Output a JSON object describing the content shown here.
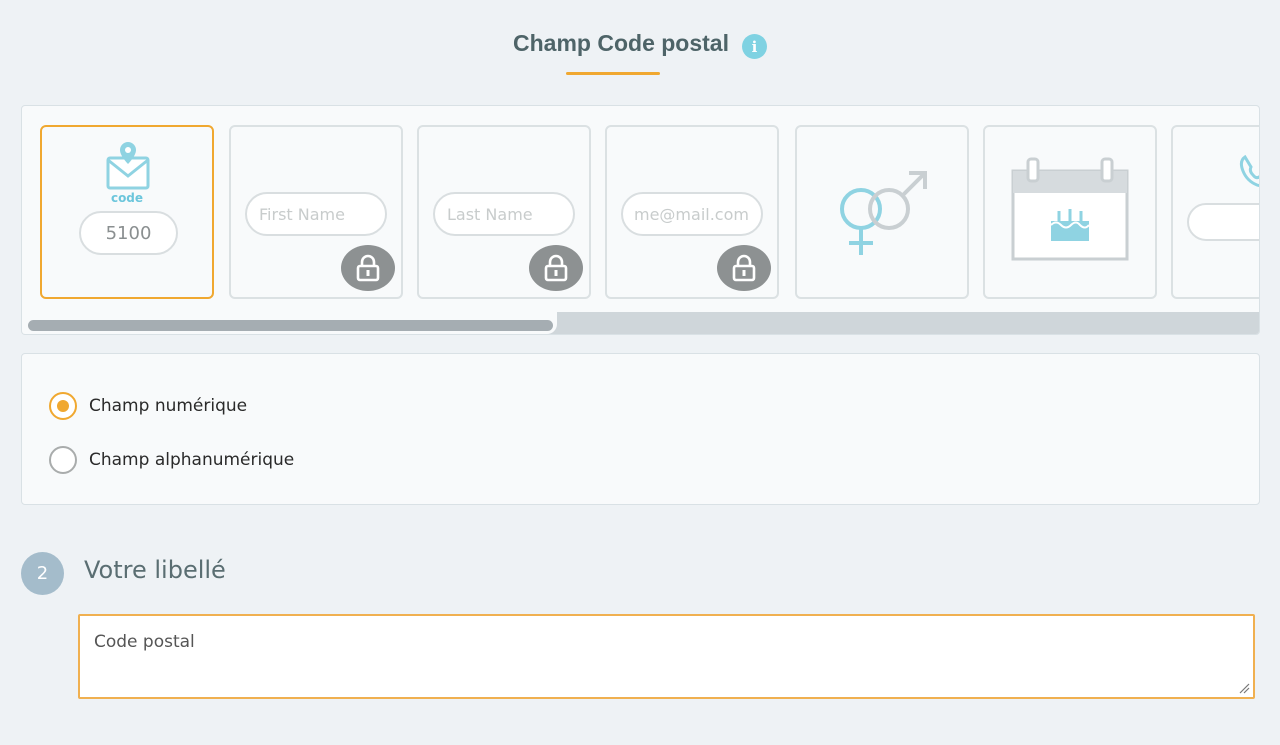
{
  "header": {
    "title": "Champ Code postal",
    "info_icon": "info-icon",
    "accent": "#f0a830"
  },
  "cards": [
    {
      "id": "postal-code",
      "icon": "mail-location-icon",
      "caption": "code",
      "sample_value": "5100",
      "selected": true,
      "locked": false
    },
    {
      "id": "first-name",
      "placeholder": "First Name",
      "selected": false,
      "locked": true
    },
    {
      "id": "last-name",
      "placeholder": "Last Name",
      "selected": false,
      "locked": true
    },
    {
      "id": "email",
      "placeholder": "me@mail.com",
      "selected": false,
      "locked": true
    },
    {
      "id": "gender",
      "icon": "gender-icon",
      "selected": false,
      "locked": false
    },
    {
      "id": "birthday",
      "icon": "birthday-calendar-icon",
      "selected": false,
      "locked": false
    },
    {
      "id": "phone",
      "icon": "phone-icon",
      "selected": false,
      "locked": false
    }
  ],
  "field_type": {
    "options": [
      {
        "label": "Champ numérique",
        "checked": true
      },
      {
        "label": "Champ alphanumérique",
        "checked": false
      }
    ]
  },
  "step2": {
    "number": "2",
    "title": "Votre libellé",
    "value": "Code postal"
  },
  "colors": {
    "accent": "#f0a830",
    "info": "#7fd2e2",
    "icon_teal": "#8fd3e2",
    "lock": "#8d9192",
    "step_badge": "#a4bccb"
  }
}
